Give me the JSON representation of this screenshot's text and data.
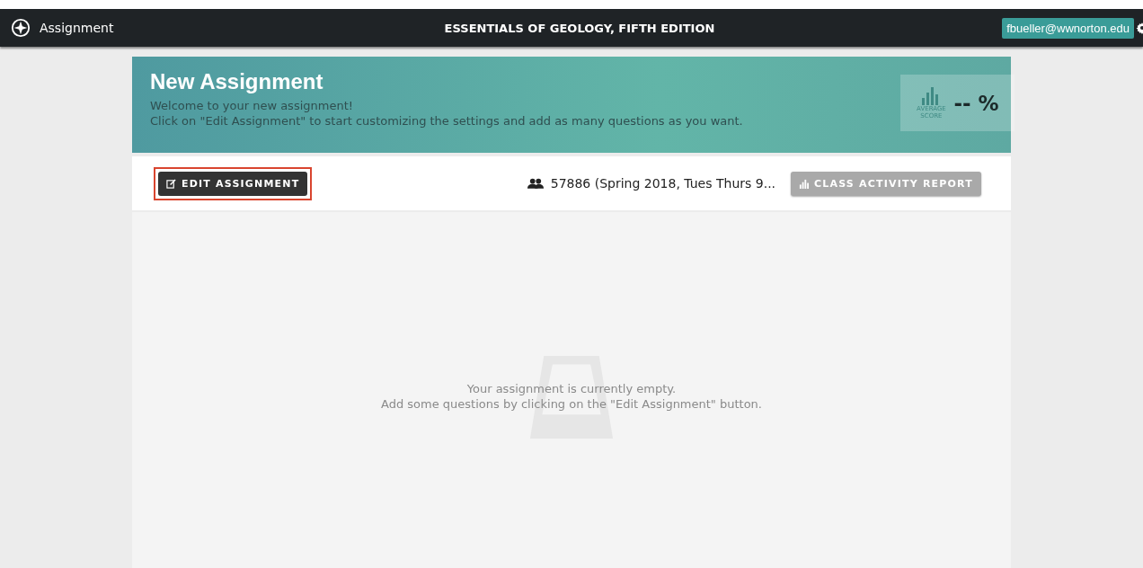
{
  "top_bar": {
    "app_name": "Assignment",
    "title": "ESSENTIALS OF GEOLOGY, FIFTH EDITION",
    "user": "fbueller@wwnorton.edu"
  },
  "header": {
    "title": "New Assignment",
    "lines": [
      "Welcome to your new assignment!",
      "Click on \"Edit Assignment\" to start customizing the settings and add as many questions as you want."
    ],
    "score_label": "AVERAGE SCORE",
    "score": "-- %"
  },
  "toolbar": {
    "buttons": [
      {
        "kind": "edit",
        "label": "EDIT ASSIGNMENT",
        "highlighted": true,
        "disabled": false
      },
      {
        "kind": "report",
        "label": "CLASS ACTIVITY REPORT",
        "highlighted": false,
        "disabled": true
      }
    ],
    "class_name": "57886 (Spring 2018, Tues Thurs 9..."
  },
  "empty_state": {
    "lines": [
      "Your assignment is currently empty.",
      "Add some questions by clicking on the \"Edit Assignment\" button."
    ]
  }
}
